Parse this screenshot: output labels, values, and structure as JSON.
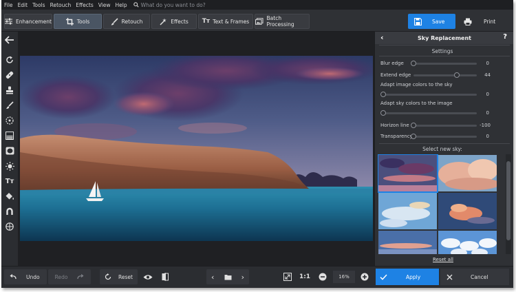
{
  "menu": {
    "items": [
      "File",
      "Edit",
      "Tools",
      "Retouch",
      "Effects",
      "View",
      "Help"
    ],
    "search_placeholder": "What do you want to do?"
  },
  "toolbar": {
    "tabs": [
      "Enhancement",
      "Tools",
      "Retouch",
      "Effects",
      "Text & Frames",
      "Batch Processing"
    ],
    "active_tab": "Tools",
    "save_label": "Save",
    "print_label": "Print"
  },
  "panel": {
    "title": "Sky Replacement",
    "settings_label": "Settings",
    "params": [
      {
        "label": "Blur edge",
        "value": "0",
        "level": 0.0
      },
      {
        "label": "Extend edge",
        "value": "44",
        "level": 0.44
      },
      {
        "label": "Adapt image colors to the sky",
        "value": "0",
        "level": 0.0
      },
      {
        "label": "Adapt sky colors to the image",
        "value": "0",
        "level": 0.0
      },
      {
        "label": "Horizon line",
        "value": "-100",
        "level": 0.0
      },
      {
        "label": "Transparency",
        "value": "0",
        "level": 0.0
      }
    ],
    "select_sky_label": "Select new sky:",
    "reset_all_label": "Reset all"
  },
  "bottom": {
    "undo_label": "Undo",
    "redo_label": "Redo",
    "reset_label": "Reset",
    "ratio_label": "1:1",
    "zoom_value": "16%",
    "apply_label": "Apply",
    "cancel_label": "Cancel"
  },
  "colors": {
    "accent": "#1e82e4",
    "background": "#2b2d31",
    "panel": "#2f3135"
  }
}
